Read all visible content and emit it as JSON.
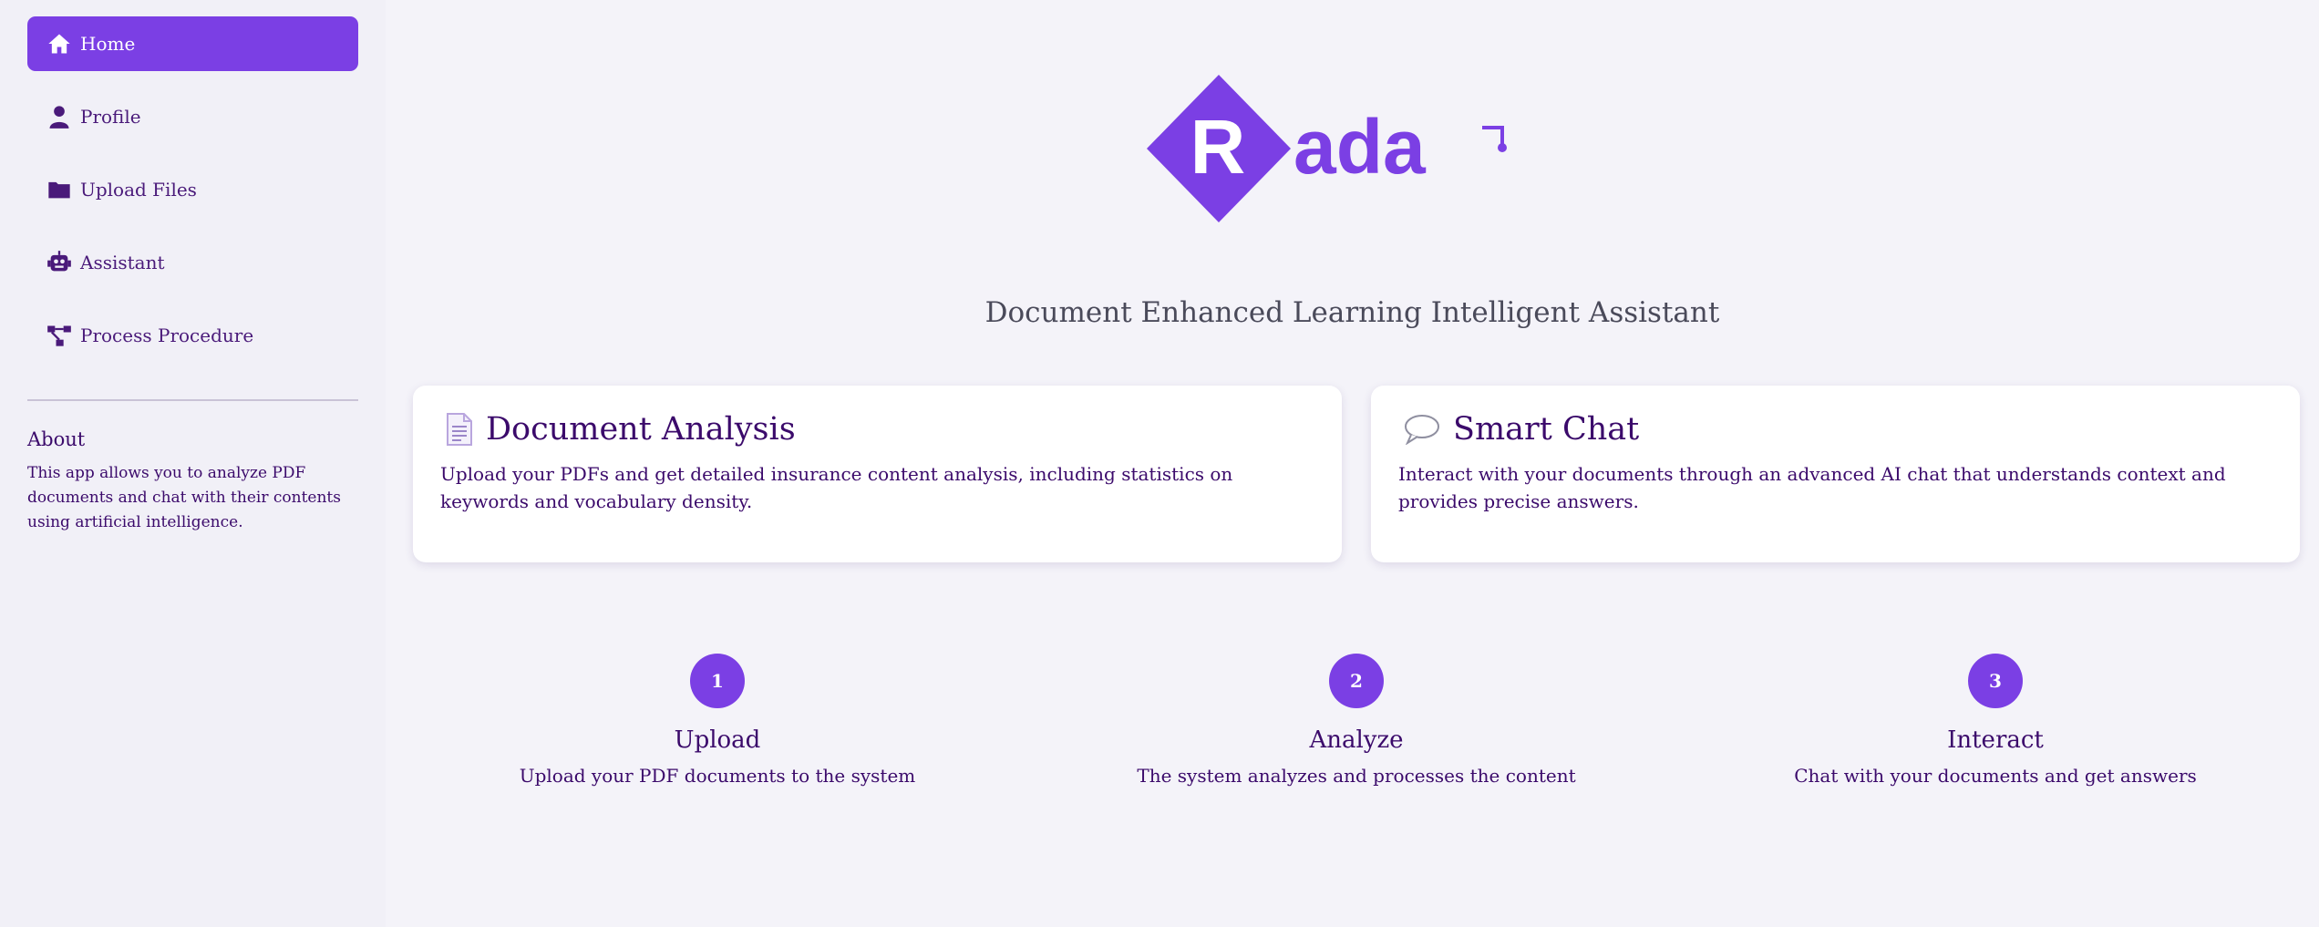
{
  "sidebar": {
    "items": [
      {
        "label": "Home",
        "icon": "home-icon",
        "active": true
      },
      {
        "label": "Profile",
        "icon": "user-icon"
      },
      {
        "label": "Upload Files",
        "icon": "folder-icon"
      },
      {
        "label": "Assistant",
        "icon": "robot-icon"
      },
      {
        "label": "Process Procedure",
        "icon": "diagram-icon"
      }
    ],
    "about_title": "About",
    "about_text": "This app allows you to analyze PDF documents and chat with their contents using artificial intelligence."
  },
  "logo": {
    "letter": "R",
    "text": "ada",
    "color": "#7b3fe4"
  },
  "subtitle": "Document Enhanced Learning Intelligent Assistant",
  "cards": [
    {
      "icon": "document-icon",
      "title": "Document Analysis",
      "desc": "Upload your PDFs and get detailed insurance content analysis, including statistics on keywords and vocabulary density."
    },
    {
      "icon": "speech-bubble-icon",
      "title": "Smart Chat",
      "desc": "Interact with your documents through an advanced AI chat that understands context and provides precise answers."
    }
  ],
  "steps": [
    {
      "num": "1",
      "title": "Upload",
      "desc": "Upload your PDF documents to the system"
    },
    {
      "num": "2",
      "title": "Analyze",
      "desc": "The system analyzes and processes the content"
    },
    {
      "num": "3",
      "title": "Interact",
      "desc": "Chat with your documents and get answers"
    }
  ],
  "colors": {
    "accent": "#7b3fe4",
    "text": "#3b0a6b",
    "background": "#f4f3f9"
  }
}
